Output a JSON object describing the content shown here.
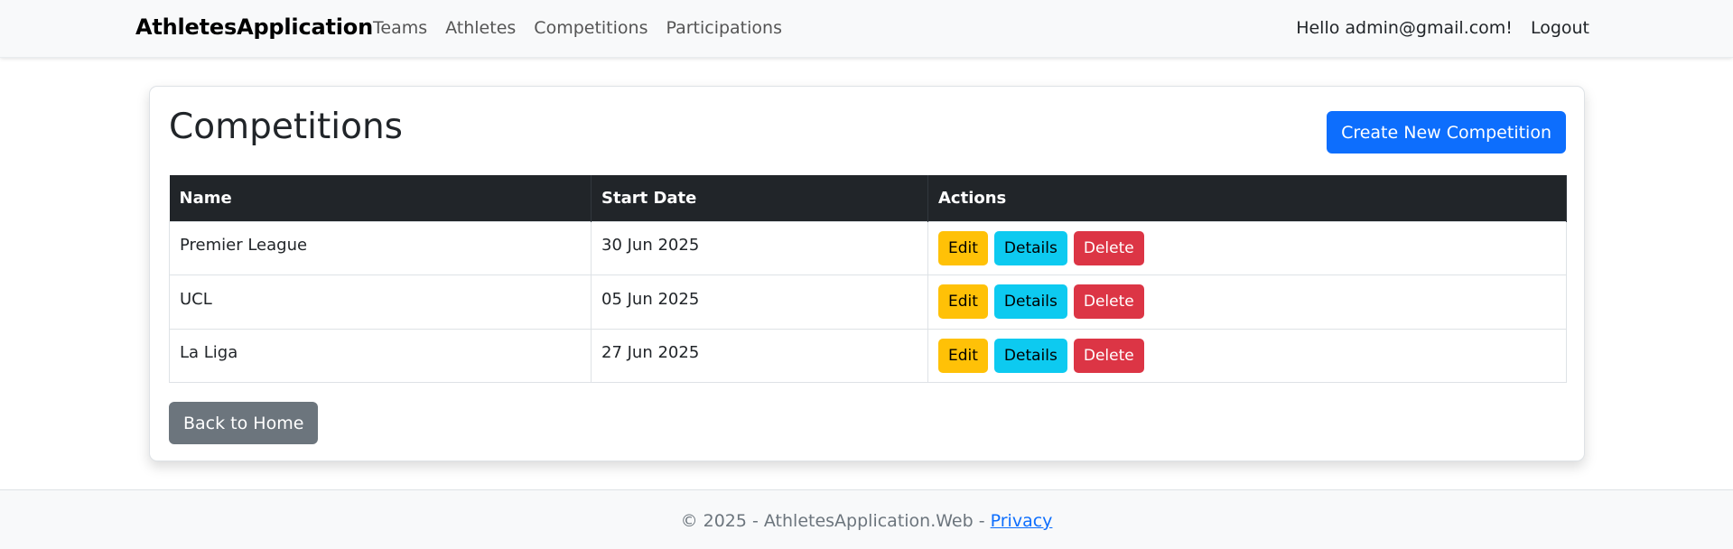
{
  "navbar": {
    "brand": "AthletesApplication",
    "links": [
      "Teams",
      "Athletes",
      "Competitions",
      "Participations"
    ],
    "greeting": "Hello admin@gmail.com!",
    "logout": "Logout"
  },
  "main": {
    "title": "Competitions",
    "create_button": "Create New Competition",
    "table": {
      "headers": [
        "Name",
        "Start Date",
        "Actions"
      ],
      "rows": [
        {
          "name": "Premier League",
          "start_date": "30 Jun 2025"
        },
        {
          "name": "UCL",
          "start_date": "05 Jun 2025"
        },
        {
          "name": "La Liga",
          "start_date": "27 Jun 2025"
        }
      ],
      "actions": {
        "edit": "Edit",
        "details": "Details",
        "delete": "Delete"
      }
    },
    "back_button": "Back to Home"
  },
  "footer": {
    "text": "© 2025 - AthletesApplication.Web - ",
    "privacy": "Privacy"
  },
  "colors": {
    "primary": "#0d6efd",
    "warning": "#ffc107",
    "info": "#0dcaf0",
    "danger": "#dc3545",
    "secondary": "#6c757d",
    "table_header": "#212529"
  }
}
